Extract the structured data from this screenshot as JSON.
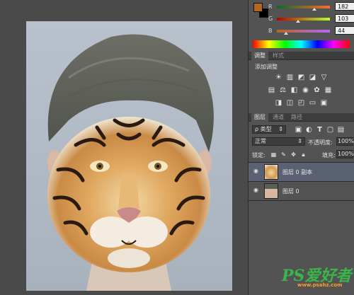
{
  "color_panel": {
    "foreground_color": "#b5651e",
    "background_color": "#000000",
    "sliders": [
      {
        "label": "R",
        "value": "182",
        "level": 0.71,
        "gradient": [
          "#0a6b2c",
          "#ff6b2c"
        ]
      },
      {
        "label": "G",
        "value": "103",
        "level": 0.4,
        "gradient": [
          "#b50000",
          "#b5ff2c"
        ]
      },
      {
        "label": "B",
        "value": "44",
        "level": 0.17,
        "gradient": [
          "#b5671e",
          "#b567ff"
        ]
      }
    ]
  },
  "adjustments_panel": {
    "tabs": [
      "调整",
      "样式"
    ],
    "active_tab": 0,
    "heading": "添加调整",
    "icon_rows": [
      [
        "brightness-icon",
        "levels-icon",
        "curves-icon",
        "exposure-icon",
        "vibrance-icon"
      ],
      [
        "hue-saturation-icon",
        "color-balance-icon",
        "black-white-icon",
        "photo-filter-icon",
        "channel-mixer-icon",
        "color-lookup-icon"
      ],
      [
        "invert-icon",
        "posterize-icon",
        "threshold-icon",
        "gradient-map-icon",
        "selective-color-icon"
      ]
    ]
  },
  "layers_panel": {
    "tabs": [
      "图层",
      "通道",
      "路径"
    ],
    "active_tab": 0,
    "filter_kind": "ρ 类型",
    "blend_mode": "正常",
    "opacity_label": "不透明度:",
    "opacity_value": "100%",
    "lock_label": "锁定:",
    "fill_label": "填充:",
    "fill_value": "100%",
    "layers": [
      {
        "name": "图层 0 副本",
        "selected": true,
        "thumb": "tiger"
      },
      {
        "name": "图层 0",
        "selected": false,
        "thumb": "portrait"
      }
    ]
  },
  "watermark": {
    "brand": "PS爱好者",
    "url": "www.psahz.com"
  }
}
